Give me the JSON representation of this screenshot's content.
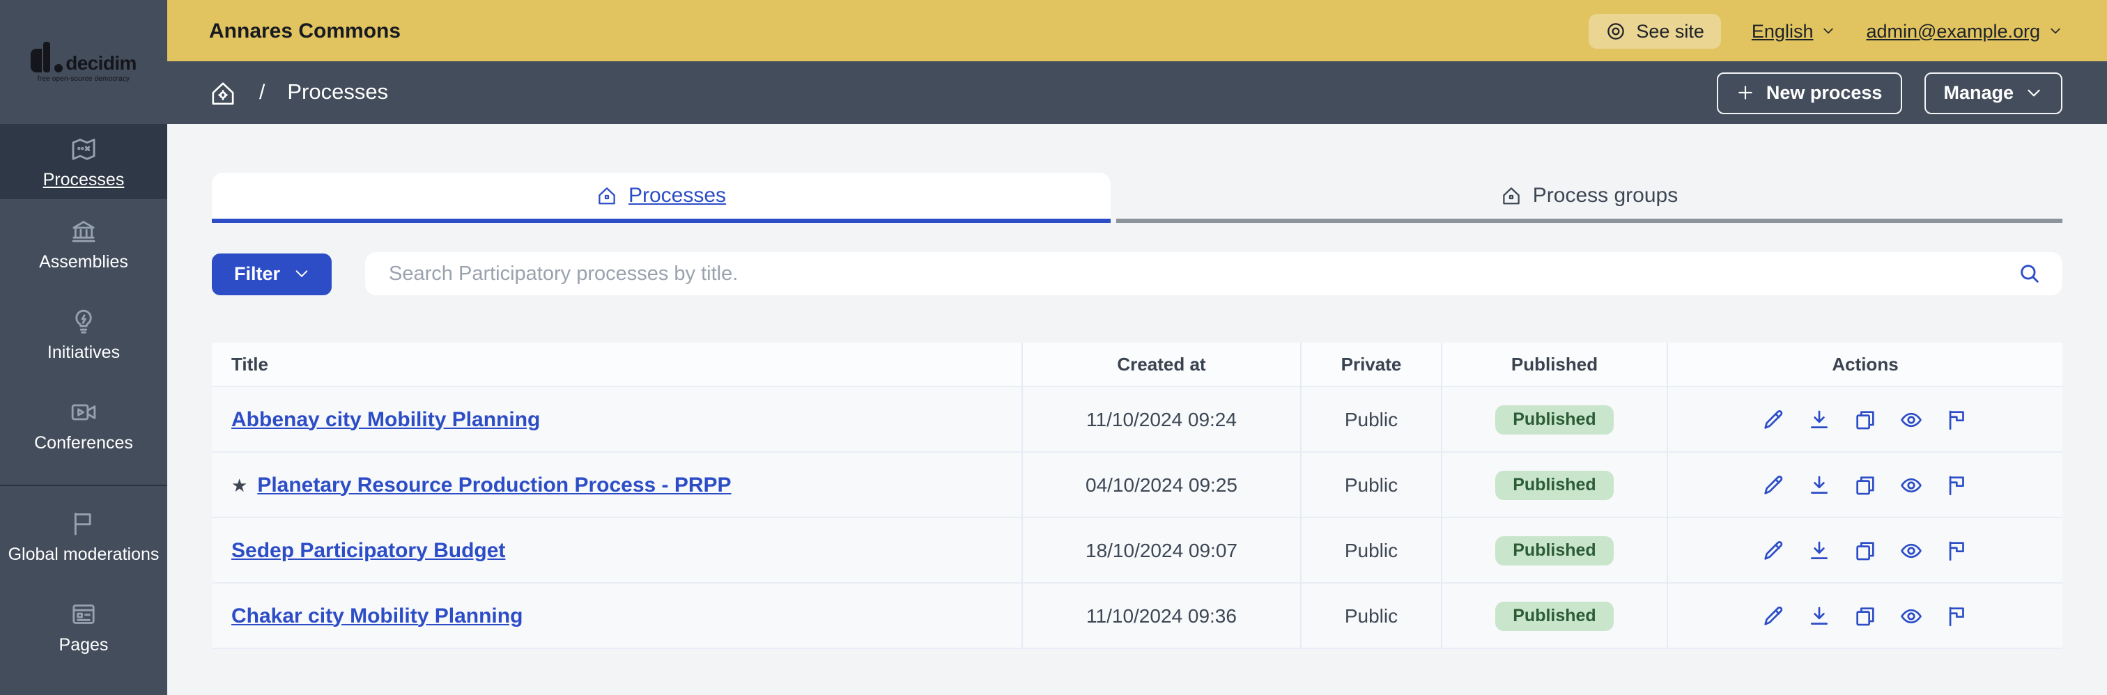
{
  "colors": {
    "topbar_yellow": "#e1c35f",
    "slate": "#434d5b",
    "slate_active": "#2f3846",
    "accent_blue": "#2c4dc6",
    "badge_green_bg": "#c9e5cb",
    "badge_green_text": "#2b5c37",
    "content_bg": "#f3f4f6"
  },
  "brand": {
    "logo_text": "decidim",
    "tagline": "free open-source democracy"
  },
  "topbar": {
    "org_name": "Annares Commons",
    "see_site": "See site",
    "language": "English",
    "user_email": "admin@example.org"
  },
  "breadcrumb": {
    "separator": "/",
    "current": "Processes"
  },
  "subbar_actions": {
    "new_process": "New process",
    "manage": "Manage"
  },
  "sidebar": {
    "items": [
      {
        "label": "Processes",
        "active": true
      },
      {
        "label": "Assemblies",
        "active": false
      },
      {
        "label": "Initiatives",
        "active": false
      },
      {
        "label": "Conferences",
        "active": false
      },
      {
        "label": "Global moderations",
        "active": false
      },
      {
        "label": "Pages",
        "active": false
      }
    ]
  },
  "tabs": [
    {
      "label": "Processes",
      "active": true
    },
    {
      "label": "Process groups",
      "active": false
    }
  ],
  "filter": {
    "button_label": "Filter"
  },
  "search": {
    "placeholder": "Search Participatory processes by title."
  },
  "table": {
    "columns": [
      "Title",
      "Created at",
      "Private",
      "Published",
      "Actions"
    ],
    "action_icons": [
      "edit",
      "download",
      "duplicate",
      "preview",
      "flag"
    ],
    "rows": [
      {
        "title": "Abbenay city Mobility Planning",
        "created_at": "11/10/2024 09:24",
        "private": "Public",
        "published": "Published"
      },
      {
        "title": "Planetary Resource Production Process - PRPP",
        "star": "★",
        "created_at": "04/10/2024 09:25",
        "private": "Public",
        "published": "Published"
      },
      {
        "title": "Sedep Participatory Budget",
        "created_at": "18/10/2024 09:07",
        "private": "Public",
        "published": "Published"
      },
      {
        "title": "Chakar city Mobility Planning",
        "created_at": "11/10/2024 09:36",
        "private": "Public",
        "published": "Published"
      }
    ]
  }
}
